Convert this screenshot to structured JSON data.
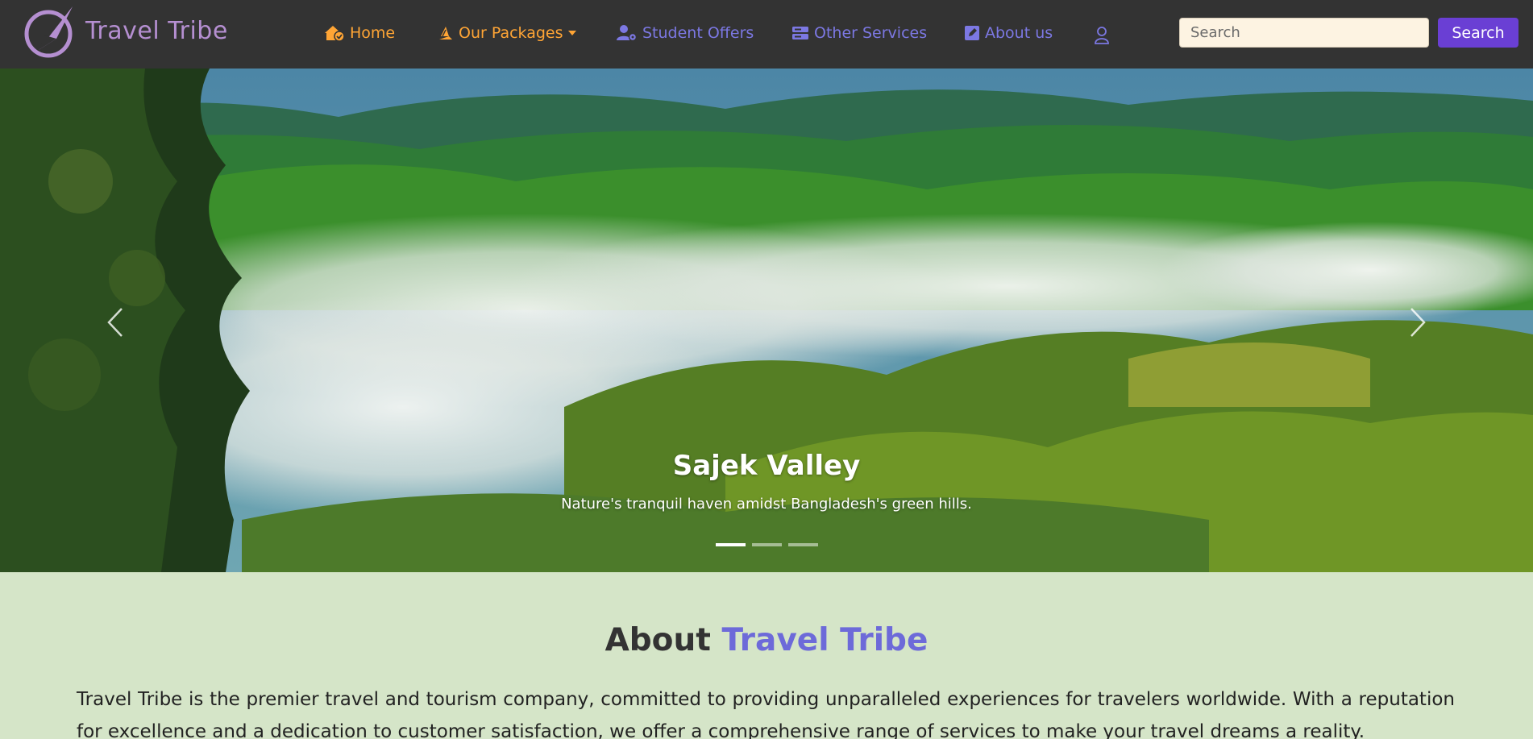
{
  "brand": {
    "name": "Travel Tribe",
    "logo_icon": "compass-logo-icon"
  },
  "nav": {
    "home": "Home",
    "packages": "Our Packages",
    "student_offers": "Student Offers",
    "other_services": "Other Services",
    "about": "About us",
    "user_icon": "user-icon"
  },
  "search": {
    "placeholder": "Search",
    "button": "Search"
  },
  "hero": {
    "slide_title": "Sajek Valley",
    "slide_subtitle": "Nature's tranquil haven amidst Bangladesh's green hills.",
    "slide_count": 3,
    "active_slide": 1
  },
  "about": {
    "title_plain": "About",
    "title_accent": "Travel Tribe",
    "body": "Travel Tribe is the premier travel and tourism company, committed to providing unparalleled experiences for travelers worldwide. With a reputation for excellence and a dedication to customer satisfaction, we offer a comprehensive range of services to make your travel dreams a reality."
  },
  "colors": {
    "navbar_bg": "#333333",
    "brand": "#b58fd1",
    "nav_orange": "#ffa535",
    "nav_purple": "#7c78e3",
    "search_button": "#6a3fd4",
    "about_bg": "#d5e5c8",
    "about_accent": "#6d6ad9"
  }
}
